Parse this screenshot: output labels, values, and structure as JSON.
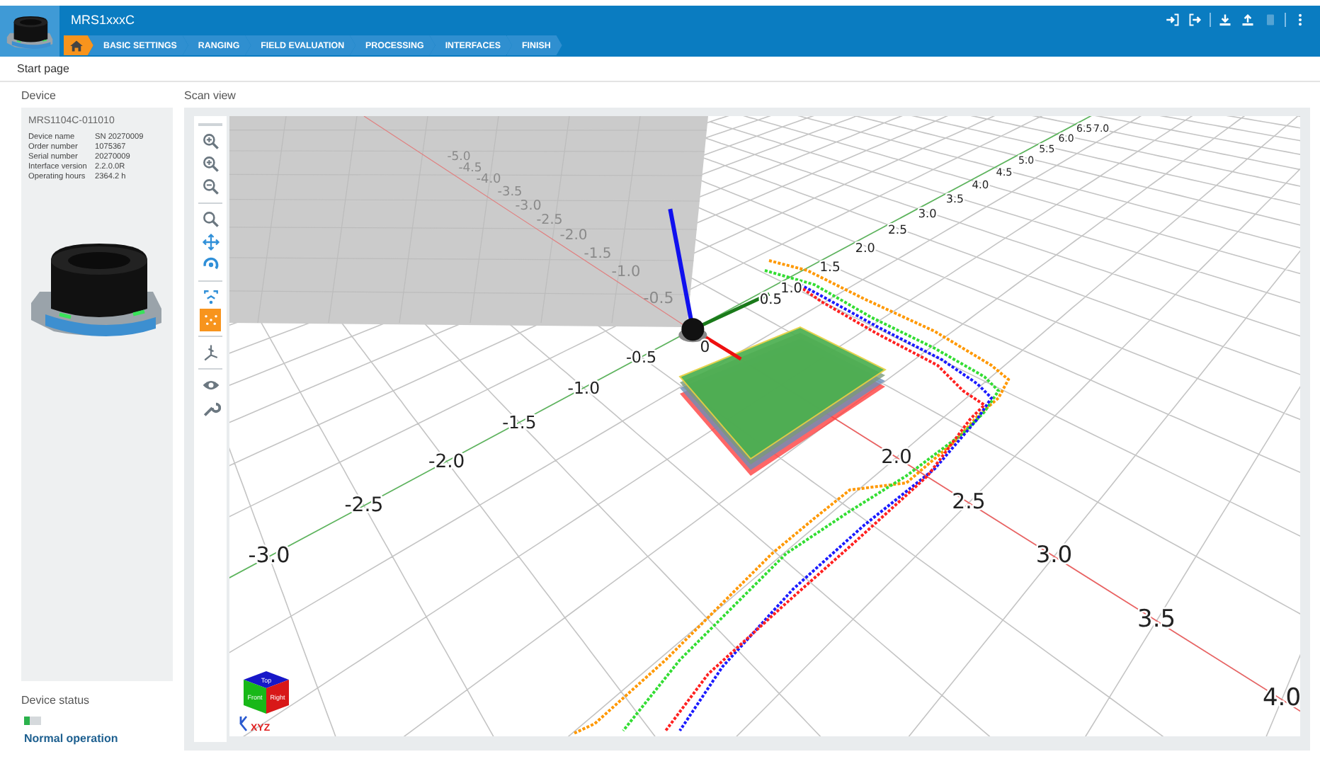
{
  "header": {
    "title": "MRS1xxxC"
  },
  "header_actions": [
    [
      {
        "disabled": false
      },
      {
        "disabled": false
      }
    ],
    [
      {
        "disabled": false
      },
      {
        "disabled": false
      },
      {
        "disabled": true
      }
    ],
    [
      {
        "disabled": false
      }
    ]
  ],
  "breadcrumb": {
    "home": {
      "selected": true
    },
    "steps": [
      {
        "label": "BASIC SETTINGS",
        "selected": false
      },
      {
        "label": "RANGING",
        "selected": false
      },
      {
        "label": "FIELD EVALUATION",
        "selected": false
      },
      {
        "label": "PROCESSING",
        "selected": false
      },
      {
        "label": "INTERFACES",
        "selected": false
      },
      {
        "label": "FINISH",
        "selected": false
      }
    ]
  },
  "page_title": "Start page",
  "device": {
    "heading": "Device",
    "title": "MRS1104C-011010",
    "rows": [
      {
        "label": "Device name",
        "value": "SN 20270009"
      },
      {
        "label": "Order number",
        "value": "1075367"
      },
      {
        "label": "Serial number",
        "value": "20270009"
      },
      {
        "label": "Interface version",
        "value": "2.2.0.0R"
      },
      {
        "label": "Operating hours",
        "value": "2364.2 h"
      }
    ]
  },
  "device_status": {
    "heading": "Device status",
    "level": 0.33,
    "text": "Normal operation"
  },
  "scan_view": {
    "heading": "Scan view",
    "toolbar": [
      [
        {
          "selected": false
        },
        {
          "selected": false
        },
        {
          "selected": false
        }
      ],
      [
        {
          "selected": false
        },
        {
          "selected": false
        },
        {
          "selected": false
        }
      ],
      [
        {
          "selected": false
        },
        {
          "selected": true
        }
      ],
      [
        {
          "selected": false
        }
      ],
      [
        {
          "selected": false
        },
        {
          "selected": false
        }
      ]
    ],
    "wall_labels": [
      "-0.5",
      "-1.0",
      "-1.5",
      "-2.0",
      "-2.5",
      "-3.0",
      "-3.5",
      "-4.0",
      "-4.5",
      "-5.0"
    ],
    "green_positive_labels": [
      "0.5",
      "1.0",
      "1.5",
      "2.0",
      "2.5",
      "3.0",
      "3.5",
      "4.0",
      "4.5",
      "5.0",
      "5.5",
      "6.0",
      "6.5",
      "7.0"
    ],
    "green_negative_labels": [
      "-0.5",
      "-1.0",
      "-1.5",
      "-2.0",
      "-2.5",
      "-3.0"
    ],
    "red_origin_label": "0",
    "red_far_labels": [
      "2.0",
      "2.5",
      "3.0",
      "3.5",
      "4.0"
    ],
    "nav_cube": {
      "faces": [
        "Top",
        "Front",
        "Right"
      ],
      "axes": "XYZ"
    }
  }
}
